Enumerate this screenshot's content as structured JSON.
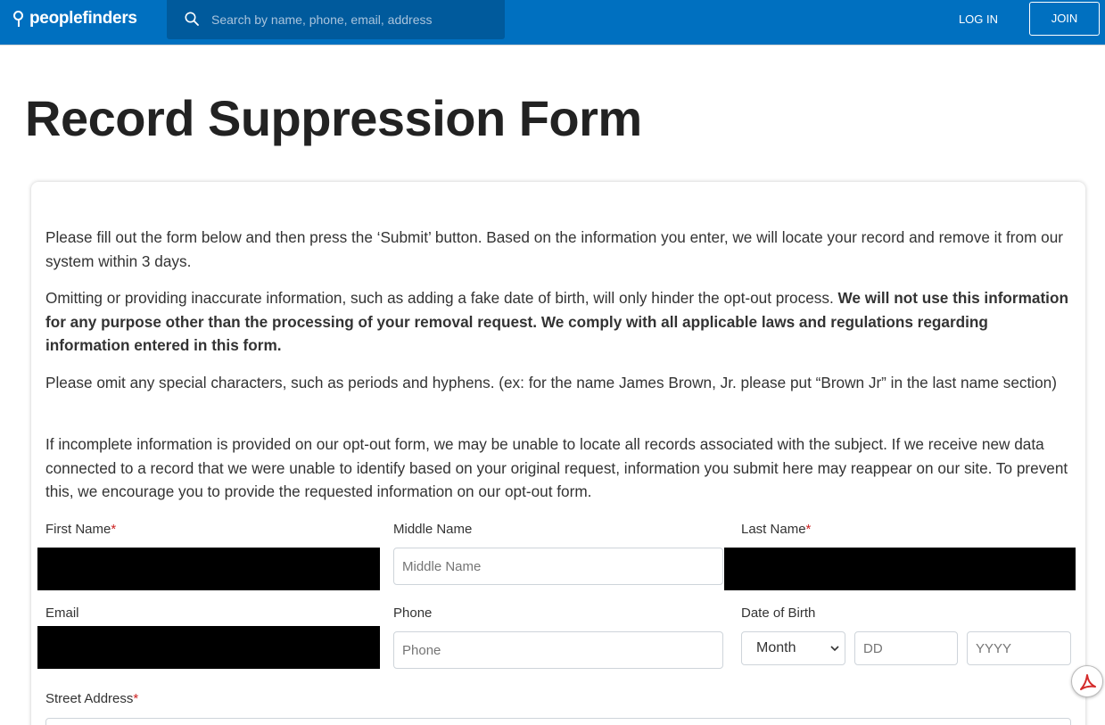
{
  "header": {
    "logo_text": "peoplefinders",
    "search_placeholder": "Search by name, phone, email, address",
    "login_label": "LOG IN",
    "join_label": "JOIN",
    "brand_color": "#0070c0"
  },
  "page": {
    "title": "Record Suppression Form"
  },
  "intro": {
    "p1": "Please fill out the form below and then press the ‘Submit’ button. Based on the information you enter, we will locate your record and remove it from our system within 3 days.",
    "p2_normal": "Omitting or providing inaccurate information, such as adding a fake date of birth, will only hinder the opt-out process. ",
    "p2_bold": "We will not use this information for any purpose other than the processing of your removal request. We comply with all applicable laws and regulations regarding information entered in this form.",
    "p3": "Please omit any special characters, such as periods and hyphens. (ex: for the name James Brown, Jr. please put “Brown Jr” in the last name section)",
    "p4": "If incomplete information is provided on our opt-out form, we may be unable to locate all records associated with the subject. If we receive new data connected to a record that we were unable to identify based on your original request, information you submit here may reappear on our site. To prevent this, we encourage you to provide the requested information on our opt-out form."
  },
  "form": {
    "first_name_label": "First Name",
    "middle_name_label": "Middle Name",
    "middle_name_placeholder": "Middle Name",
    "last_name_label": "Last Name",
    "email_label": "Email",
    "phone_label": "Phone",
    "phone_placeholder": "Phone",
    "dob_label": "Date of Birth",
    "dob_month_selected": "Month",
    "dob_day_placeholder": "DD",
    "dob_year_placeholder": "YYYY",
    "street_label": "Street Address",
    "required_marker": "*"
  },
  "icons": {
    "search": "search-icon",
    "location_pin": "location-pin-icon",
    "pdf": "adobe-pdf-icon",
    "dropdown": "chevron-down-icon"
  }
}
